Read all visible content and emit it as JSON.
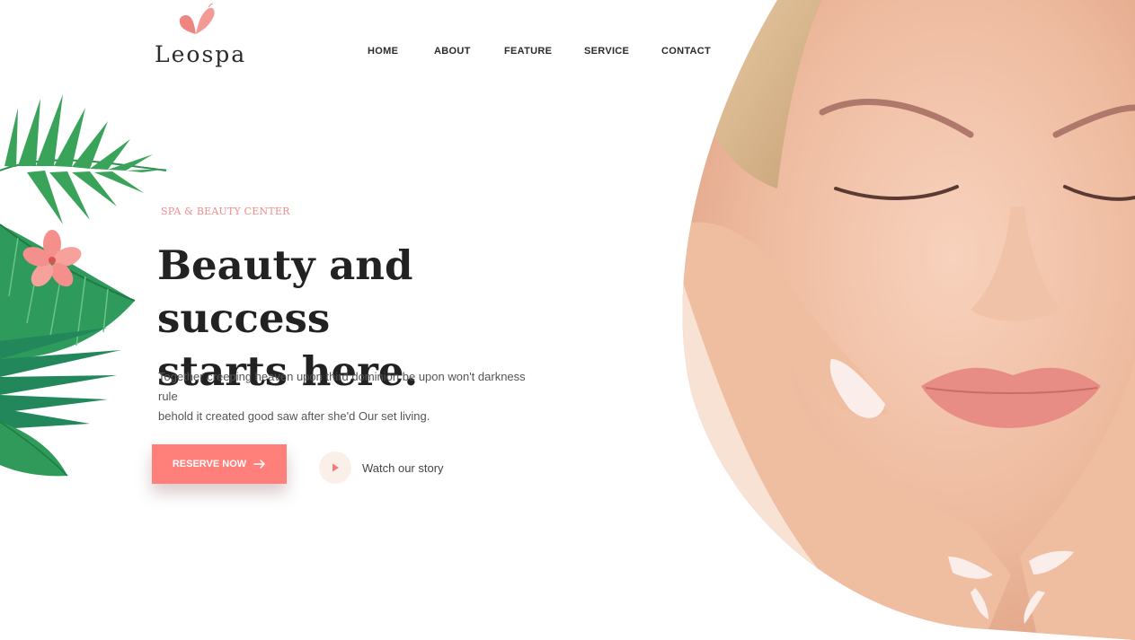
{
  "brand": {
    "name": "Leospa",
    "logo_icon": "butterfly-icon",
    "accent_color": "#ff7f7a"
  },
  "nav": {
    "items": [
      {
        "label": "HOME"
      },
      {
        "label": "ABOUT"
      },
      {
        "label": "FEATURE"
      },
      {
        "label": "SERVICE"
      },
      {
        "label": "CONTACT"
      }
    ]
  },
  "hero": {
    "kicker": "SPA & BEAUTY CENTER",
    "title_line1": "Beauty and success",
    "title_line2": "starts here.",
    "description_line1": "Together creeping heaven upon third dominion be upon won't darkness rule",
    "description_line2": "behold it created good saw after she'd Our set living.",
    "reserve_button": {
      "label": "RESERVE NOW",
      "icon": "arrow-right-icon"
    },
    "watch_link": {
      "label": "Watch our story",
      "icon": "play-icon"
    }
  },
  "decor": {
    "leaves": "tropical-leaves-illustration",
    "hero_image": "facial-massage-photo"
  }
}
